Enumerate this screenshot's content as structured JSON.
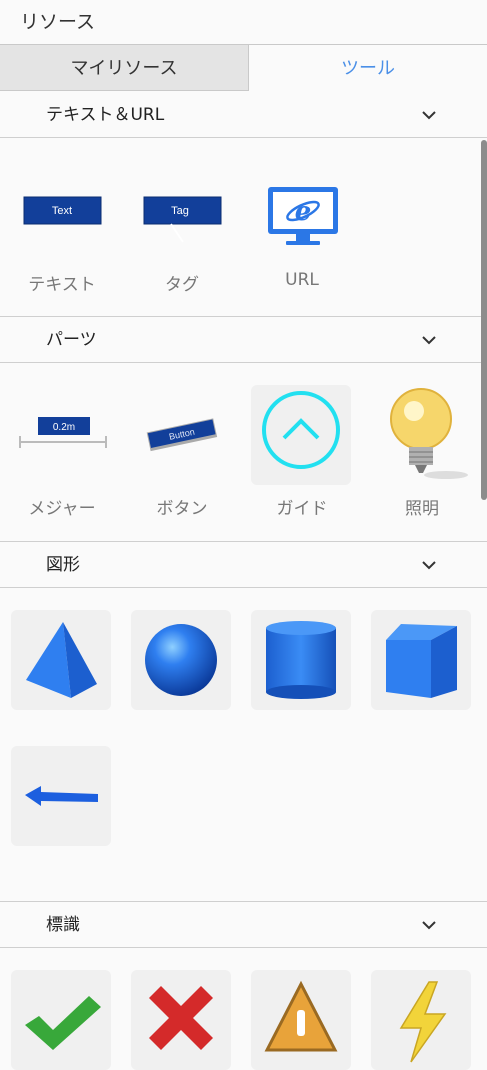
{
  "header": {
    "title": "リソース"
  },
  "tabs": {
    "my_resources": "マイリソース",
    "tools": "ツール"
  },
  "sections": {
    "text_url": {
      "title": "テキスト＆URL",
      "items": {
        "text": "テキスト",
        "tag": "タグ",
        "url": "URL"
      },
      "thumb_text": {
        "text": "Text",
        "tag": "Tag"
      }
    },
    "parts": {
      "title": "パーツ",
      "items": {
        "measure": "メジャー",
        "button": "ボタン",
        "guide": "ガイド",
        "light": "照明"
      },
      "thumb_text": {
        "measure": "0.2m",
        "button": "Button"
      }
    },
    "shapes": {
      "title": "図形"
    },
    "signs": {
      "title": "標識"
    }
  },
  "colors": {
    "accent": "#4a8fe7",
    "shape_blue": "#2f7ff0",
    "guide_cyan": "#22e0f0"
  }
}
